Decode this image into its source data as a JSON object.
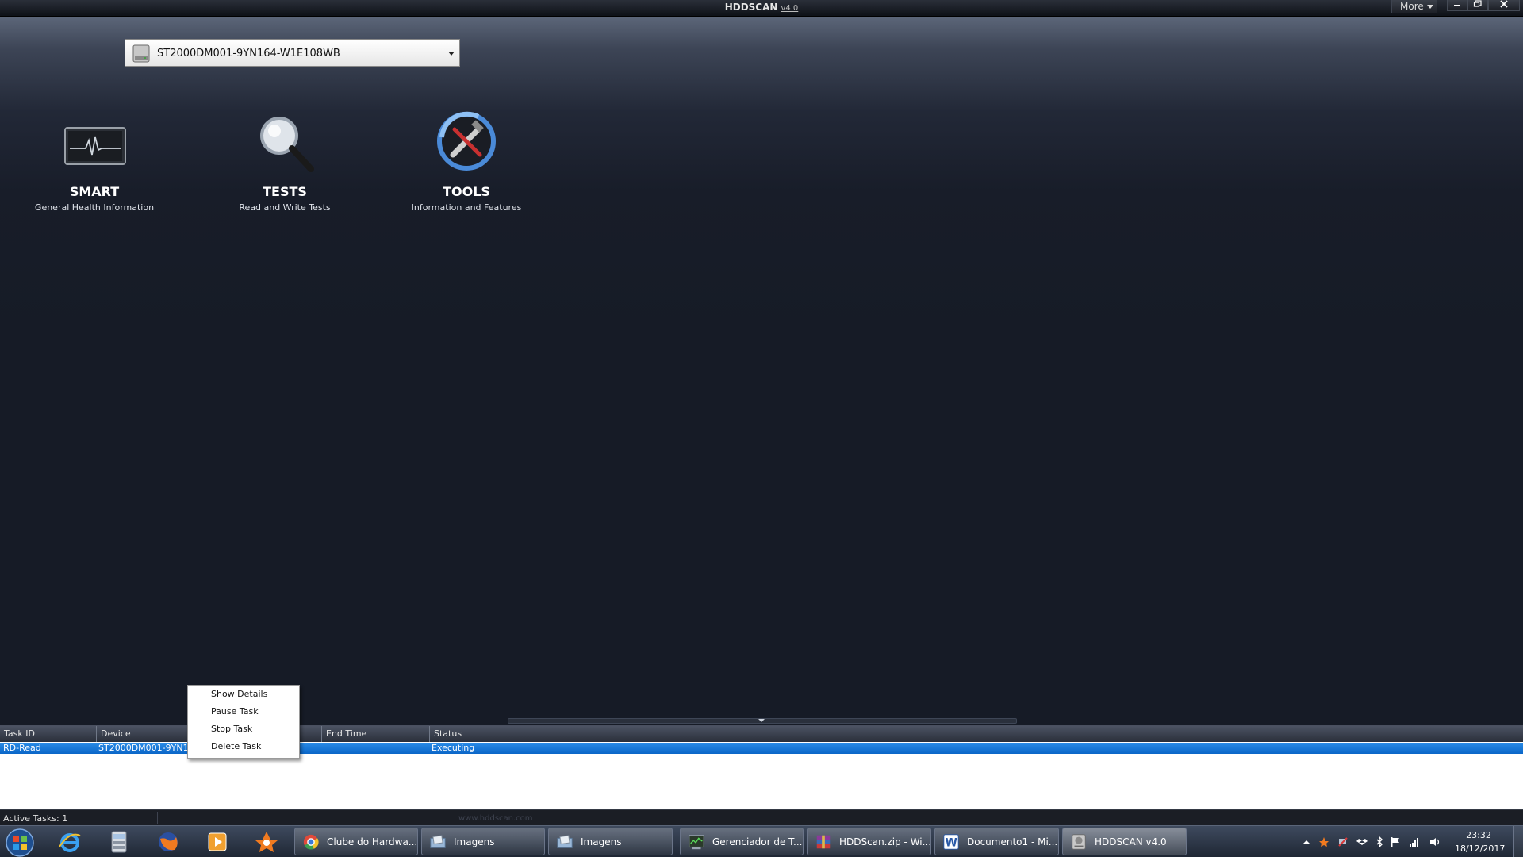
{
  "window": {
    "title": "HDDSCAN",
    "version": "v4.0",
    "more_label": "More",
    "controls": [
      "minimize-icon",
      "maximize-icon",
      "close-icon"
    ]
  },
  "device_select": {
    "value": "ST2000DM001-9YN164-W1E108WB"
  },
  "modules": [
    {
      "title": "SMART",
      "subtitle": "General Health Information",
      "icon": "heartbeat-monitor-icon"
    },
    {
      "title": "TESTS",
      "subtitle": "Read and Write Tests",
      "icon": "magnifier-icon"
    },
    {
      "title": "TOOLS",
      "subtitle": "Information and Features",
      "icon": "tools-icon"
    }
  ],
  "task_table": {
    "columns": [
      "Task ID",
      "Device",
      "",
      "End Time",
      "Status"
    ],
    "rows": [
      {
        "task_id": "RD-Read",
        "device": "ST2000DM001-9YN164",
        "end_time": "",
        "status": "Executing"
      }
    ]
  },
  "context_menu": {
    "items": [
      "Show Details",
      "Pause Task",
      "Stop Task",
      "Delete Task"
    ]
  },
  "status_bar": {
    "active_tasks": "Active Tasks: 1",
    "site": "www.hddscan.com"
  },
  "taskbar": {
    "pinned": [
      "internet-explorer-icon",
      "calculator-icon",
      "firefox-icon",
      "media-player-icon",
      "avast-icon"
    ],
    "buttons": [
      {
        "label": "Clube do Hardwa...",
        "icon": "chrome-icon"
      },
      {
        "label": "Imagens",
        "icon": "folder-icon"
      },
      {
        "label": "Imagens",
        "icon": "folder-icon"
      },
      {
        "label": "Gerenciador de T...",
        "icon": "task-manager-icon"
      },
      {
        "label": "HDDScan.zip - Wi...",
        "icon": "winrar-icon"
      },
      {
        "label": "Documento1 - Mi...",
        "icon": "word-icon"
      },
      {
        "label": "HDDSCAN v4.0",
        "icon": "hddscan-icon"
      }
    ],
    "clock_time": "23:32",
    "clock_date": "18/12/2017",
    "tray_icons": [
      "arrow-up-icon",
      "avast-tray-icon",
      "network-tool-icon",
      "dropbox-icon",
      "bluetooth-icon",
      "flag-icon",
      "signal-icon",
      "volume-icon"
    ]
  },
  "colors": {
    "accent_blue": "#0a66c8",
    "bg_dark": "#161b26"
  }
}
